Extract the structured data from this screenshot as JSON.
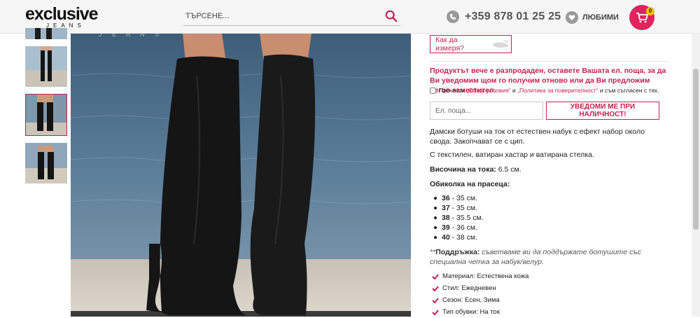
{
  "header": {
    "logo_main": "exclusive",
    "logo_sub": "JEANS",
    "search_placeholder": "ТЪРСЕНЕ...",
    "phone": "+359 878 01 25 25",
    "favorites": "ЛЮБИМИ",
    "cart_count": "0"
  },
  "colors": {
    "accent": "#c4214f",
    "cart": "#e0245e",
    "badge": "#f3c300"
  },
  "product": {
    "measure_button": "Как да измеря?",
    "soldout_notice": "Продуктът вече е разпродаден, оставете Вашата ел. поща, за да Ви уведомим щом го получим отново или да Ви предложим негов заместител.",
    "consent": {
      "prefix": "Прочетох",
      "terms": "„Общи условия“",
      "and": "и",
      "privacy": "„Политика за поверителност“",
      "suffix": "и съм съгласен с тях."
    },
    "email_placeholder": "Ел. поща...",
    "notify_button": "УВЕДОМИ МЕ ПРИ НАЛИЧНОСТ!",
    "description": "Дамски ботуши на ток от естествен набук с ефект набор около свода. Закопчават се с цип.",
    "lining": "С текстилен, ватиран хастар и ватирана стелка.",
    "heel_label": "Височина на тока:",
    "heel_value": "6.5 см.",
    "calf_label": "Обиколка на прасеца:",
    "sizes": [
      {
        "size": "36",
        "value": "- 35 см."
      },
      {
        "size": "37",
        "value": "- 35 см."
      },
      {
        "size": "38",
        "value": "- 35.5 см."
      },
      {
        "size": "39",
        "value": "- 36 см."
      },
      {
        "size": "40",
        "value": "- 38 см."
      }
    ],
    "care_prefix": "**",
    "care_label": "Поддръжка:",
    "care_text": "съветваме ви да поддържате ботушите със специална четка за набук/велур.",
    "features": [
      "Материал: Естествена кожа",
      "Стил: Ежедневен",
      "Сезон: Есен, Зима",
      "Тип обувки: На ток"
    ]
  },
  "icons": [
    "search-icon",
    "phone-icon",
    "heart-icon",
    "cart-icon",
    "footprint-icon",
    "check-icon"
  ]
}
